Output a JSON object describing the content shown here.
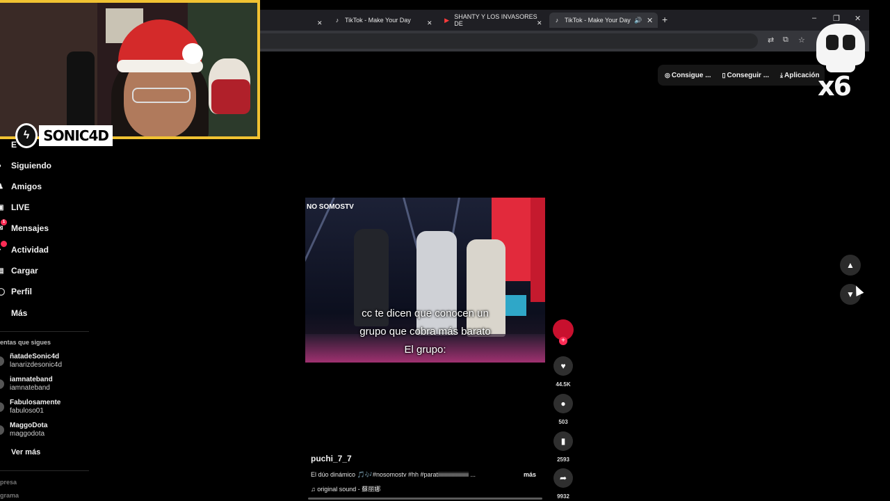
{
  "browser": {
    "tabs": [
      {
        "label": "TikTok - Make Your Day",
        "favicon": "tiktok-icon"
      },
      {
        "label": "SHANTY Y LOS INVASORES DE",
        "favicon": "youtube-icon"
      },
      {
        "label": "TikTok - Make Your Day",
        "favicon": "tiktok-icon",
        "active": true
      }
    ],
    "new_tab": "+",
    "window_controls": {
      "minimize": "–",
      "maximize": "❐",
      "close": "✕"
    }
  },
  "header": {
    "coins_label": "Consigue ...",
    "app_label": "Conseguir ...",
    "install_label": "Aplicación"
  },
  "overlay": {
    "streamer_name": "SONIC4D",
    "skull_count": "x6"
  },
  "sidebar": {
    "partial_item": "E",
    "items": [
      {
        "label": "Siguiendo",
        "icon": "following-icon"
      },
      {
        "label": "Amigos",
        "icon": "friends-icon"
      },
      {
        "label": "LIVE",
        "icon": "live-icon"
      },
      {
        "label": "Mensajes",
        "icon": "messages-icon",
        "badge": "1"
      },
      {
        "label": "Actividad",
        "icon": "activity-icon",
        "badge": ""
      },
      {
        "label": "Cargar",
        "icon": "upload-icon"
      },
      {
        "label": "Perfil",
        "icon": "profile-icon"
      },
      {
        "label": "Más",
        "icon": "more-icon"
      }
    ],
    "following_title": "entas que sigues",
    "accounts": [
      {
        "name": "ñatadeSonic4d",
        "handle": "lanarizdesonic4d"
      },
      {
        "name": "iamnateband",
        "handle": "iamnateband"
      },
      {
        "name": "Fabulosamente",
        "handle": "fabuloso01"
      },
      {
        "name": "MaggoDota",
        "handle": "maggodota"
      }
    ],
    "see_more": "Ver más",
    "footer": [
      "presa",
      "grama"
    ]
  },
  "video": {
    "watermark": "NO SOMOSTV",
    "captions": [
      "cc te dicen que conocen un",
      "grupo que cobra más barato",
      "El grupo:"
    ]
  },
  "actions": {
    "likes": "44.5K",
    "comments": "503",
    "saves": "2593",
    "shares": "9932"
  },
  "post": {
    "author": "puchi_7_7",
    "description": "El dúo dinámico 🎵🎶#nosomostv #hh #paratiiiiiiiiiiiiiiiiiiiiii ...",
    "more_label": "más",
    "sound": "original sound - 蘇丽娜"
  }
}
